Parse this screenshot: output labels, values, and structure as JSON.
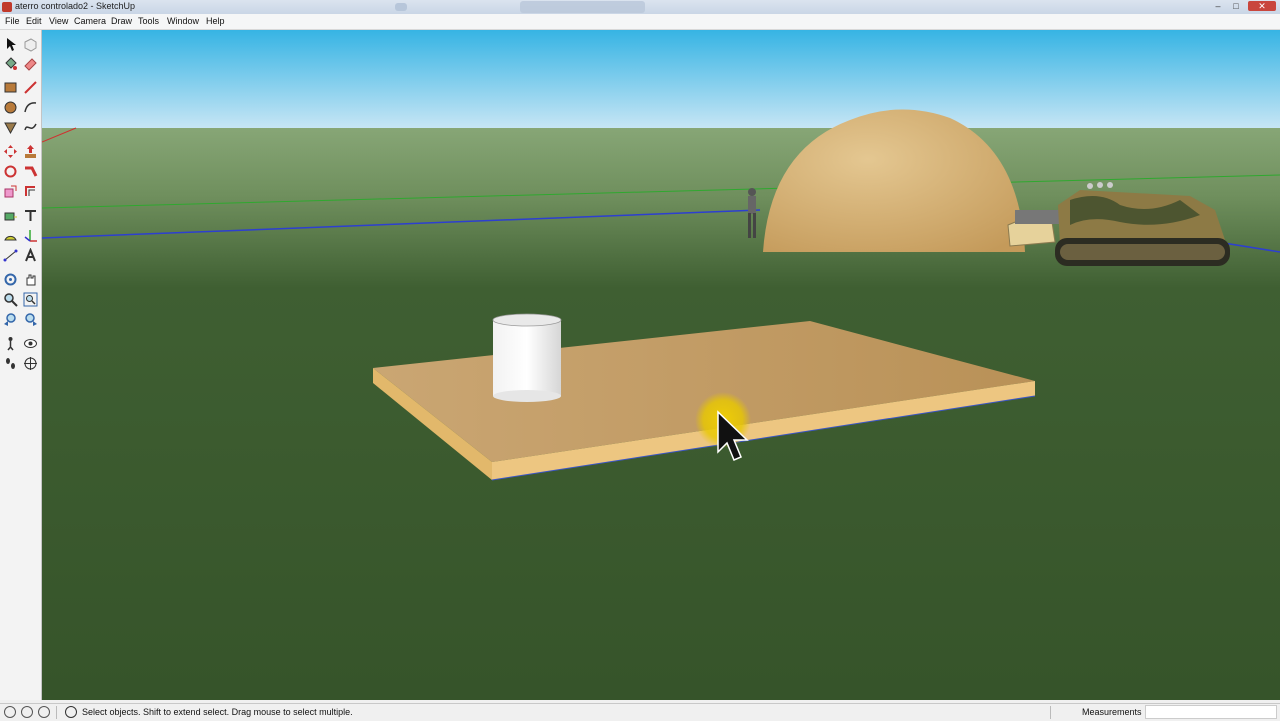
{
  "window": {
    "title": "aterro controlado2 - SketchUp"
  },
  "menu": [
    "File",
    "Edit",
    "View",
    "Camera",
    "Draw",
    "Tools",
    "Window",
    "Help"
  ],
  "toolbar": {
    "tools": [
      "select-tool",
      "make-component-tool",
      "paint-bucket-tool",
      "eraser-tool",
      "rectangle-tool",
      "line-tool",
      "circle-tool",
      "arc-tool",
      "polygon-tool",
      "freehand-tool",
      "move-tool",
      "push-pull-tool",
      "rotate-tool",
      "follow-me-tool",
      "scale-tool",
      "offset-tool",
      "tape-measure-tool",
      "text-tool",
      "protractor-tool",
      "axes-tool",
      "dimension-tool",
      "3d-text-tool",
      "orbit-tool",
      "pan-tool",
      "zoom-tool",
      "zoom-extents-tool",
      "previous-view-tool",
      "next-view-tool",
      "position-camera-tool",
      "look-around-tool",
      "walk-tool",
      "section-plane-tool"
    ]
  },
  "status": {
    "hint": "Select objects. Shift to extend select. Drag mouse to select multiple.",
    "measurements_label": "Measurements",
    "measurements_value": ""
  },
  "colors": {
    "sky_top": "#36b4e4",
    "sky_bottom": "#c9e6f5",
    "ground": "#3a5a2e",
    "horizon_band": "#8aaa78",
    "sand": "#d6b27a",
    "cursor_highlight": "#f2d100"
  }
}
